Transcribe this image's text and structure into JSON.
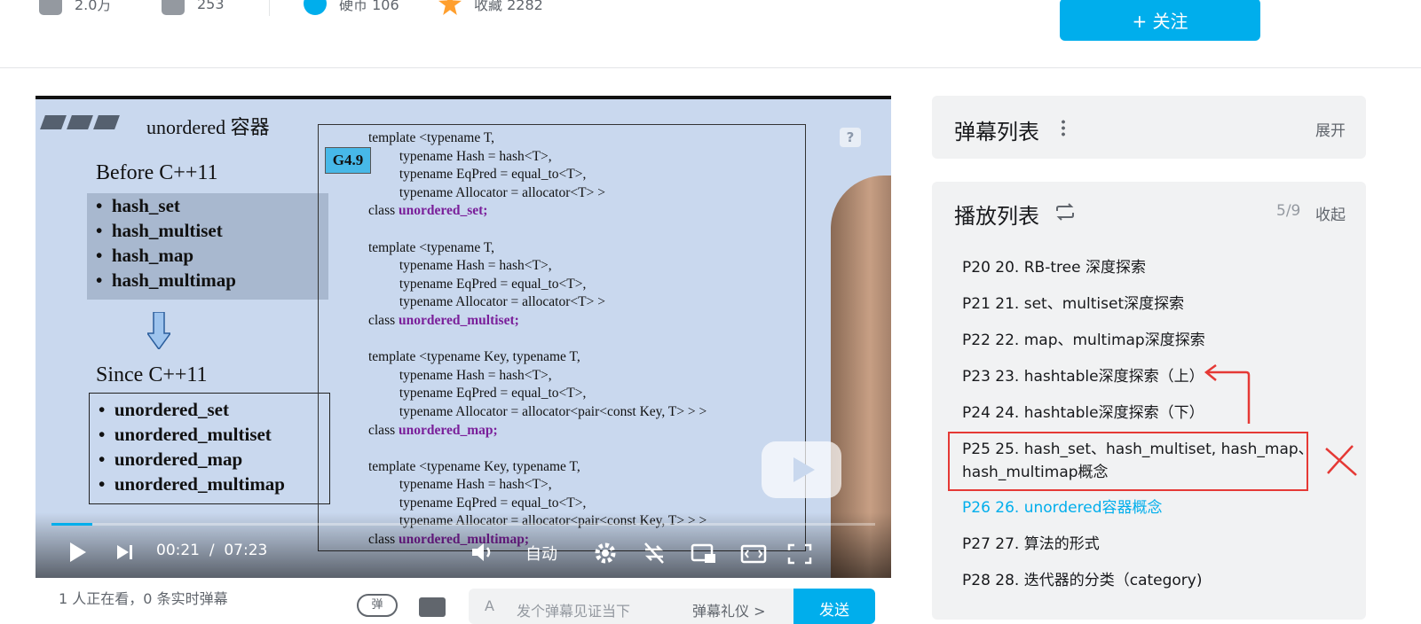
{
  "stats": {
    "views": "2.0万",
    "danmaku": "253",
    "coins": "硬币 106",
    "favorites": "收藏 2282"
  },
  "follow_button": "+ 关注",
  "video": {
    "slide_title": "unordered 容器",
    "before_label": "Before C++11",
    "before_items": [
      "hash_set",
      "hash_multiset",
      "hash_map",
      "hash_multimap"
    ],
    "since_label": "Since C++11",
    "since_items": [
      "unordered_set",
      "unordered_multiset",
      "unordered_map",
      "unordered_multimap"
    ],
    "version_badge": "G4.9",
    "code_blocks": [
      {
        "lines": [
          "template <typename T,",
          "         typename Hash = hash<T>,",
          "         typename EqPred = equal_to<T>,",
          "         typename Allocator = allocator<T> >",
          "class "
        ],
        "name": "unordered_set;"
      },
      {
        "lines": [
          "template <typename T,",
          "         typename Hash = hash<T>,",
          "         typename EqPred = equal_to<T>,",
          "         typename Allocator = allocator<T> >",
          "class "
        ],
        "name": "unordered_multiset;"
      },
      {
        "lines": [
          "template <typename Key, typename T,",
          "         typename Hash = hash<T>,",
          "         typename EqPred = equal_to<T>,",
          "         typename Allocator = allocator<pair<const Key, T> > >",
          "class "
        ],
        "name": "unordered_map;"
      },
      {
        "lines": [
          "template <typename Key, typename T,",
          "         typename Hash = hash<T>,",
          "         typename EqPred = equal_to<T>,",
          "         typename Allocator = allocator<pair<const Key, T> > >",
          "class "
        ],
        "name": "unordered_multimap;"
      }
    ],
    "help_mark": "?",
    "current_time": "00:21",
    "time_sep": "/",
    "duration": "07:23",
    "auto_label": "自动",
    "progress_fraction": 0.05
  },
  "below": {
    "watching": "1 人正在看",
    "danmaku_count": "0 条实时弹幕",
    "danmu_toggle": "弹",
    "input_placeholder": "发个弹幕见证当下",
    "etiquette": "弹幕礼仪 >",
    "send": "发送"
  },
  "danmaku_panel": {
    "title": "弹幕列表",
    "expand": "展开"
  },
  "playlist": {
    "title": "播放列表",
    "progress": "5/9",
    "collapse": "收起",
    "items": [
      "P20 20. RB-tree 深度探索",
      "P21 21. set、multiset深度探索",
      "P22 22. map、multimap深度探索",
      "P23 23. hashtable深度探索（上）",
      "P24 24. hashtable深度探索（下）",
      "P25 25. hash_set、hash_multiset, hash_map、",
      "hash_multimap概念",
      "P26 26. unordered容器概念",
      "P27 27. 算法的形式",
      "P28 28. 迭代器的分类（category)"
    ]
  },
  "colors": {
    "accent": "#00aeec",
    "annotation": "#e53935"
  }
}
